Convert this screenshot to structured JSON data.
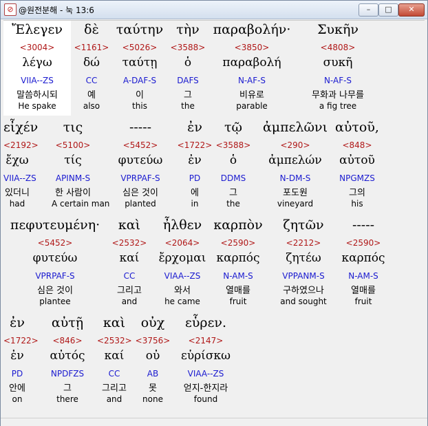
{
  "window": {
    "title": "@원전분해 - 눅 13:6",
    "icon": "diagonal-slash-icon",
    "minimize": "–",
    "maximize": "□",
    "close": "✕"
  },
  "rows": [
    [
      {
        "greek": "Ἔλεγεν",
        "strong": "<3004>",
        "lemma": "λέγω",
        "parse": "VIIA--ZS",
        "korean": "말씀하시되",
        "english": "He spake",
        "highlight": true
      },
      {
        "greek": "δὲ",
        "strong": "<1161>",
        "lemma": "δώ",
        "parse": "CC",
        "korean": "예",
        "english": "also"
      },
      {
        "greek": "ταύτην",
        "strong": "<5026>",
        "lemma": "ταύτῃ",
        "parse": "A-DAF-S",
        "korean": "이",
        "english": "this"
      },
      {
        "greek": "τὴν",
        "strong": "<3588>",
        "lemma": "ὁ",
        "parse": "DAFS",
        "korean": "그",
        "english": "the"
      },
      {
        "greek": "παραβολήν·",
        "strong": "<3850>",
        "lemma": "παραβολή",
        "parse": "N-AF-S",
        "korean": "비유로",
        "english": "parable"
      },
      {
        "greek": "Συκῆν",
        "strong": "<4808>",
        "lemma": "συκῆ",
        "parse": "N-AF-S",
        "korean": "무화과 나무를",
        "english": "a fig tree"
      }
    ],
    [
      {
        "greek": "εἶχέν",
        "strong": "<2192>",
        "lemma": "ἔχω",
        "parse": "VIIA--ZS",
        "korean": "있더니",
        "english": "had"
      },
      {
        "greek": "τις",
        "strong": "<5100>",
        "lemma": "τίς",
        "parse": "APINM-S",
        "korean": "한 사람이",
        "english": "A certain man"
      },
      {
        "greek": "-----",
        "strong": "<5452>",
        "lemma": "φυτεύω",
        "parse": "VPRPAF-S",
        "korean": "심은 것이",
        "english": "planted"
      },
      {
        "greek": "ἐν",
        "strong": "<1722>",
        "lemma": "ἐν",
        "parse": "PD",
        "korean": "에",
        "english": "in"
      },
      {
        "greek": "τῷ",
        "strong": "<3588>",
        "lemma": "ὁ",
        "parse": "DDMS",
        "korean": "그",
        "english": "the"
      },
      {
        "greek": "ἀμπελῶνι",
        "strong": "<290>",
        "lemma": "ἀμπελών",
        "parse": "N-DM-S",
        "korean": "포도원",
        "english": "vineyard"
      },
      {
        "greek": "αὐτοῦ,",
        "strong": "<848>",
        "lemma": "αὐτοῦ",
        "parse": "NPGMZS",
        "korean": "그의",
        "english": "his"
      }
    ],
    [
      {
        "greek": "πεφυτευμένη·",
        "strong": "<5452>",
        "lemma": "φυτεύω",
        "parse": "VPRPAF-S",
        "korean": "심은 것이",
        "english": "plantee"
      },
      {
        "greek": "καὶ",
        "strong": "<2532>",
        "lemma": "καί",
        "parse": "CC",
        "korean": "그리고",
        "english": "and"
      },
      {
        "greek": "ἦλθεν",
        "strong": "<2064>",
        "lemma": "ἔρχομαι",
        "parse": "VIAA--ZS",
        "korean": "와서",
        "english": "he came"
      },
      {
        "greek": "καρπὸν",
        "strong": "<2590>",
        "lemma": "καρπός",
        "parse": "N-AM-S",
        "korean": "열매를",
        "english": "fruit"
      },
      {
        "greek": "ζητῶν",
        "strong": "<2212>",
        "lemma": "ζητέω",
        "parse": "VPPANM-S",
        "korean": "구하였으나",
        "english": "and sought"
      },
      {
        "greek": "-----",
        "strong": "<2590>",
        "lemma": "καρπός",
        "parse": "N-AM-S",
        "korean": "열매를",
        "english": "fruit"
      }
    ],
    [
      {
        "greek": "ἐν",
        "strong": "<1722>",
        "lemma": "ἐν",
        "parse": "PD",
        "korean": "안에",
        "english": "on"
      },
      {
        "greek": "αὐτῇ",
        "strong": "<846>",
        "lemma": "αὐτός",
        "parse": "NPDFZS",
        "korean": "그",
        "english": "there"
      },
      {
        "greek": "καὶ",
        "strong": "<2532>",
        "lemma": "καί",
        "parse": "CC",
        "korean": "그리고",
        "english": "and"
      },
      {
        "greek": "οὐχ",
        "strong": "<3756>",
        "lemma": "οὐ",
        "parse": "AB",
        "korean": "못",
        "english": "none"
      },
      {
        "greek": "εὗρεν.",
        "strong": "<2147>",
        "lemma": "εὑρίσκω",
        "parse": "VIAA--ZS",
        "korean": "얻지-한지라",
        "english": "found"
      }
    ]
  ]
}
